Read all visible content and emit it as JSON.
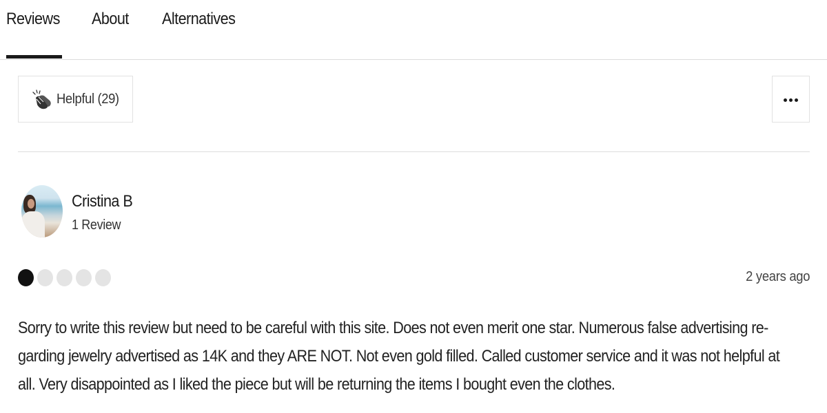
{
  "tabs": [
    {
      "label": "Reviews",
      "active": true
    },
    {
      "label": "About",
      "active": false
    },
    {
      "label": "Alternatives",
      "active": false
    }
  ],
  "actions": {
    "helpful_label": "Helpful (29)",
    "helpful_icon": "clapping-hands-icon",
    "more_icon": "more-options-icon"
  },
  "review": {
    "reviewer": {
      "name": "Cristina B",
      "review_count": "1 Review",
      "avatar": "avatar"
    },
    "rating": 1,
    "rating_max": 5,
    "date": "2 years ago",
    "text_lines": [
      "Sorry to write this review but need to be careful with this site. Does not even merit one star. Numerous false advertising re-",
      "garding jewelry advertised as 14K and they ARE NOT. Not even gold filled. Called customer service and it was not helpful at",
      "all. Very disappointed as I liked the piece but will be returning the items I bought even the clothes."
    ]
  },
  "colors": {
    "text": "#1a1a1a",
    "border": "#e1e1e1",
    "rating_filled": "#111111",
    "rating_empty": "#e4e4e4"
  }
}
